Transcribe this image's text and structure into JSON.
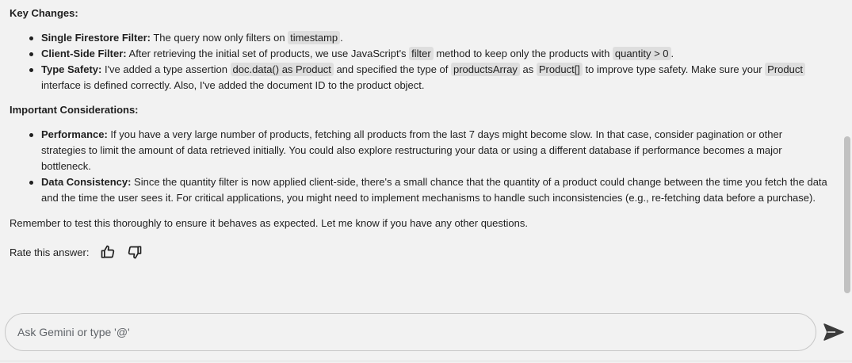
{
  "answer": {
    "key_changes_heading": "Key Changes:",
    "key_changes": [
      {
        "title": "Single Firestore Filter:",
        "t1": " The query now only filters on ",
        "c1": "timestamp",
        "t2": "."
      },
      {
        "title": "Client-Side Filter:",
        "t1": " After retrieving the initial set of products, we use JavaScript's ",
        "c1": "filter",
        "t2": " method to keep only the products with ",
        "c2": "quantity > 0",
        "t3": "."
      },
      {
        "title": "Type Safety:",
        "t1": " I've added a type assertion ",
        "c1": "doc.data() as Product",
        "t2": " and specified the type of ",
        "c2": "productsArray",
        "t3": " as ",
        "c3": "Product[]",
        "t4": " to improve type safety. Make sure your ",
        "c4": "Product",
        "t5": " interface is defined correctly. Also, I've added the document ID to the product object."
      }
    ],
    "considerations_heading": "Important Considerations:",
    "considerations": [
      {
        "title": "Performance:",
        "text": " If you have a very large number of products, fetching all products from the last 7 days might become slow. In that case, consider pagination or other strategies to limit the amount of data retrieved initially. You could also explore restructuring your data or using a different database if performance becomes a major bottleneck."
      },
      {
        "title": "Data Consistency:",
        "text": " Since the quantity filter is now applied client-side, there's a small chance that the quantity of a product could change between the time you fetch the data and the time the user sees it. For critical applications, you might need to implement mechanisms to handle such inconsistencies (e.g., re-fetching data before a purchase)."
      }
    ],
    "closing": "Remember to test this thoroughly to ensure it behaves as expected. Let me know if you have any other questions."
  },
  "rating": {
    "label": "Rate this answer:",
    "thumbs_up_icon": "thumbs-up-icon",
    "thumbs_down_icon": "thumbs-down-icon"
  },
  "input": {
    "placeholder": "Ask Gemini or type '@'",
    "value": "",
    "send_icon": "send-icon"
  }
}
